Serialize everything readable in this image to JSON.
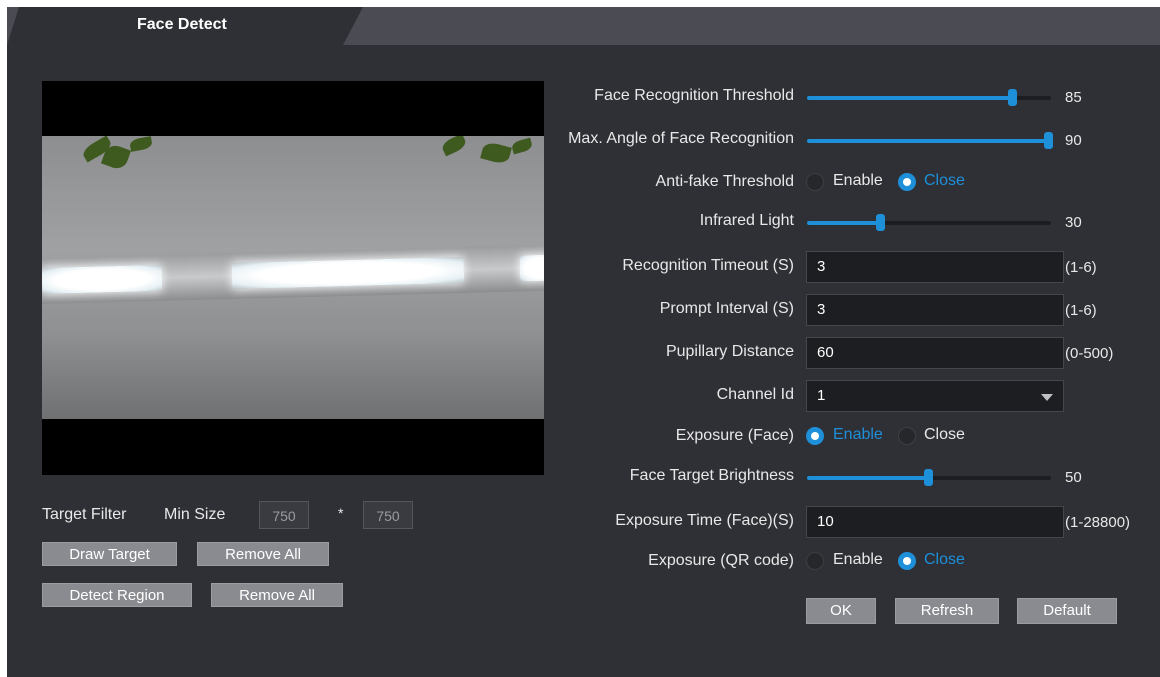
{
  "tab": {
    "label": "Face Detect"
  },
  "target_filter": {
    "label": "Target Filter",
    "min_size_label": "Min Size",
    "width": "750",
    "separator": "*",
    "height": "750",
    "draw_target_button": "Draw Target",
    "remove_all_button_1": "Remove All",
    "detect_region_button": "Detect Region",
    "remove_all_button_2": "Remove All"
  },
  "settings": {
    "face_recognition_threshold": {
      "label": "Face Recognition Threshold",
      "value": "85",
      "fraction": 0.85
    },
    "max_angle": {
      "label": "Max. Angle of Face Recognition",
      "value": "90",
      "fraction": 1.0
    },
    "anti_fake": {
      "label": "Anti-fake Threshold",
      "enable": "Enable",
      "close": "Close",
      "selected": "close"
    },
    "infrared_light": {
      "label": "Infrared Light",
      "value": "30",
      "fraction": 0.3
    },
    "recognition_timeout": {
      "label": "Recognition Timeout (S)",
      "value": "3",
      "hint": "(1-6)"
    },
    "prompt_interval": {
      "label": "Prompt Interval (S)",
      "value": "3",
      "hint": "(1-6)"
    },
    "pupillary_distance": {
      "label": "Pupillary Distance",
      "value": "60",
      "hint": "(0-500)"
    },
    "channel_id": {
      "label": "Channel Id",
      "value": "1"
    },
    "exposure_face": {
      "label": "Exposure (Face)",
      "enable": "Enable",
      "close": "Close",
      "selected": "enable"
    },
    "face_target_brightness": {
      "label": "Face Target Brightness",
      "value": "50",
      "fraction": 0.5
    },
    "exposure_time_face": {
      "label": "Exposure Time (Face)(S)",
      "value": "10",
      "hint": "(1-28800)"
    },
    "exposure_qr": {
      "label": "Exposure (QR code)",
      "enable": "Enable",
      "close": "Close",
      "selected": "close"
    }
  },
  "actions": {
    "ok": "OK",
    "refresh": "Refresh",
    "default": "Default"
  },
  "colors": {
    "accent": "#1e8fd9",
    "panel": "#2f3035",
    "tabbar": "#4a4b53",
    "button": "#8a8b90"
  }
}
